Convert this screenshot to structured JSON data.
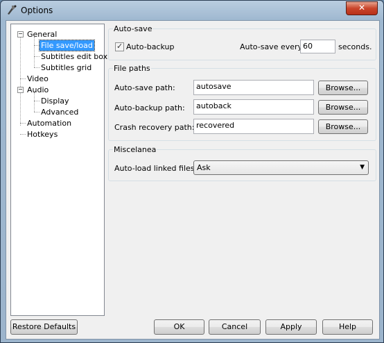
{
  "window": {
    "title": "Options",
    "close_glyph": "✕"
  },
  "tree": {
    "items": [
      {
        "label": "General"
      },
      {
        "label": "File save/load"
      },
      {
        "label": "Subtitles edit box"
      },
      {
        "label": "Subtitles grid"
      },
      {
        "label": "Video"
      },
      {
        "label": "Audio"
      },
      {
        "label": "Display"
      },
      {
        "label": "Advanced"
      },
      {
        "label": "Automation"
      },
      {
        "label": "Hotkeys"
      }
    ],
    "expanded_glyph": "−"
  },
  "autosave": {
    "title": "Auto-save",
    "backup_label": "Auto-backup",
    "backup_checked": true,
    "check_glyph": "✓",
    "every_label": "Auto-save every",
    "every_value": "60",
    "seconds_label": "seconds."
  },
  "file_paths": {
    "title": "File paths",
    "rows": [
      {
        "label": "Auto-save path:",
        "value": "autosave",
        "button": "Browse..."
      },
      {
        "label": "Auto-backup path:",
        "value": "autoback",
        "button": "Browse..."
      },
      {
        "label": "Crash recovery path:",
        "value": "recovered",
        "button": "Browse..."
      }
    ]
  },
  "misc": {
    "title": "Miscelanea",
    "autoload_label": "Auto-load linked files:",
    "autoload_value": "Ask",
    "arrow_glyph": "▼"
  },
  "buttons": {
    "restore": "Restore Defaults",
    "ok": "OK",
    "cancel": "Cancel",
    "apply": "Apply",
    "help": "Help"
  }
}
